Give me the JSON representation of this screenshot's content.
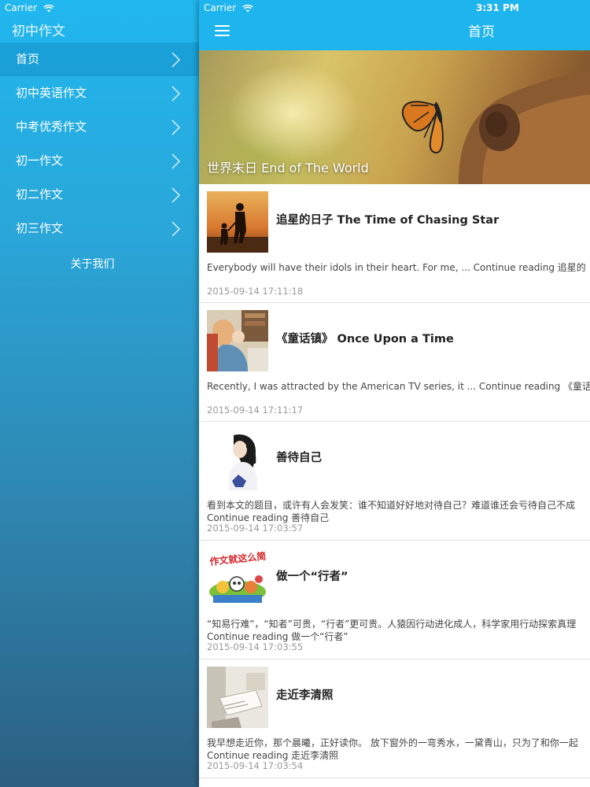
{
  "sidebar": {
    "status": {
      "carrier": "Carrier"
    },
    "title": "初中作文",
    "items": [
      {
        "label": "首页"
      },
      {
        "label": "初中英语作文"
      },
      {
        "label": "中考优秀作文"
      },
      {
        "label": "初一作文"
      },
      {
        "label": "初二作文"
      },
      {
        "label": "初三作文"
      }
    ],
    "about": "关于我们"
  },
  "main": {
    "status": {
      "carrier": "Carrier",
      "time": "3:31 PM"
    },
    "title": "首页",
    "featured": {
      "title": "世界末日 End of The World"
    },
    "articles": [
      {
        "title": "追星的日子 The Time of Chasing Star",
        "excerpt": "Everybody will have their idols in their heart. For me, ... Continue reading 追星的",
        "excerpt2": "",
        "date": "2015-09-14 17:11:18"
      },
      {
        "title": "《童话镇》 Once Upon a Time",
        "excerpt": "Recently, I was attracted by the American TV series, it ... Continue reading 《童话",
        "excerpt2": "",
        "date": "2015-09-14 17:11:17"
      },
      {
        "title": "善待自己",
        "excerpt": "看到本文的题目，或许有人会发笑：谁不知道好好地对待自己？难道谁还会亏待自己不成",
        "excerpt2": "Continue reading 善待自己",
        "date": "2015-09-14 17:03:57"
      },
      {
        "title": "做一个“行者”",
        "excerpt": "“知易行难”，“知者”可贵，“行者”更可贵。人猿因行动进化成人，科学家用行动探索真理",
        "excerpt2": "Continue reading 做一个“行者”",
        "date": "2015-09-14 17:03:55"
      },
      {
        "title": "走近李清照",
        "excerpt": "我早想走近你，那个晨曦，正好读你。 放下窗外的一弯秀水，一黛青山，只为了和你一起",
        "excerpt2": "Continue reading 走近李清照",
        "date": "2015-09-14 17:03:54"
      }
    ]
  },
  "colors": {
    "nav_bar": "#1eb4ee",
    "sidebar_top": "#21b7ef",
    "sidebar_bottom": "#2c5f81"
  }
}
